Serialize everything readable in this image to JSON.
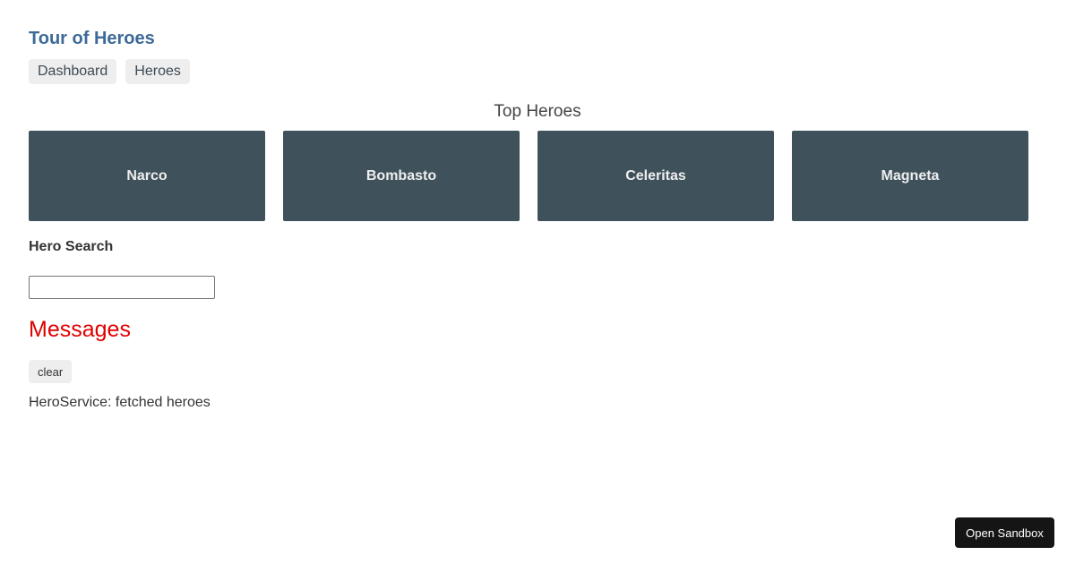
{
  "app": {
    "title": "Tour of Heroes"
  },
  "nav": {
    "items": [
      {
        "label": "Dashboard"
      },
      {
        "label": "Heroes"
      }
    ]
  },
  "dashboard": {
    "title": "Top Heroes",
    "heroes": [
      {
        "name": "Narco"
      },
      {
        "name": "Bombasto"
      },
      {
        "name": "Celeritas"
      },
      {
        "name": "Magneta"
      }
    ]
  },
  "search": {
    "title": "Hero Search",
    "value": ""
  },
  "messages": {
    "title": "Messages",
    "clear_label": "clear",
    "items": [
      "HeroService: fetched heroes"
    ]
  },
  "sandbox": {
    "label": "Open Sandbox"
  },
  "colors": {
    "title": "#3d6a98",
    "hero_card": "#3f525c",
    "messages_title": "#e00000",
    "nav_bg": "#eeeeee",
    "sandbox_bg": "#151515"
  }
}
